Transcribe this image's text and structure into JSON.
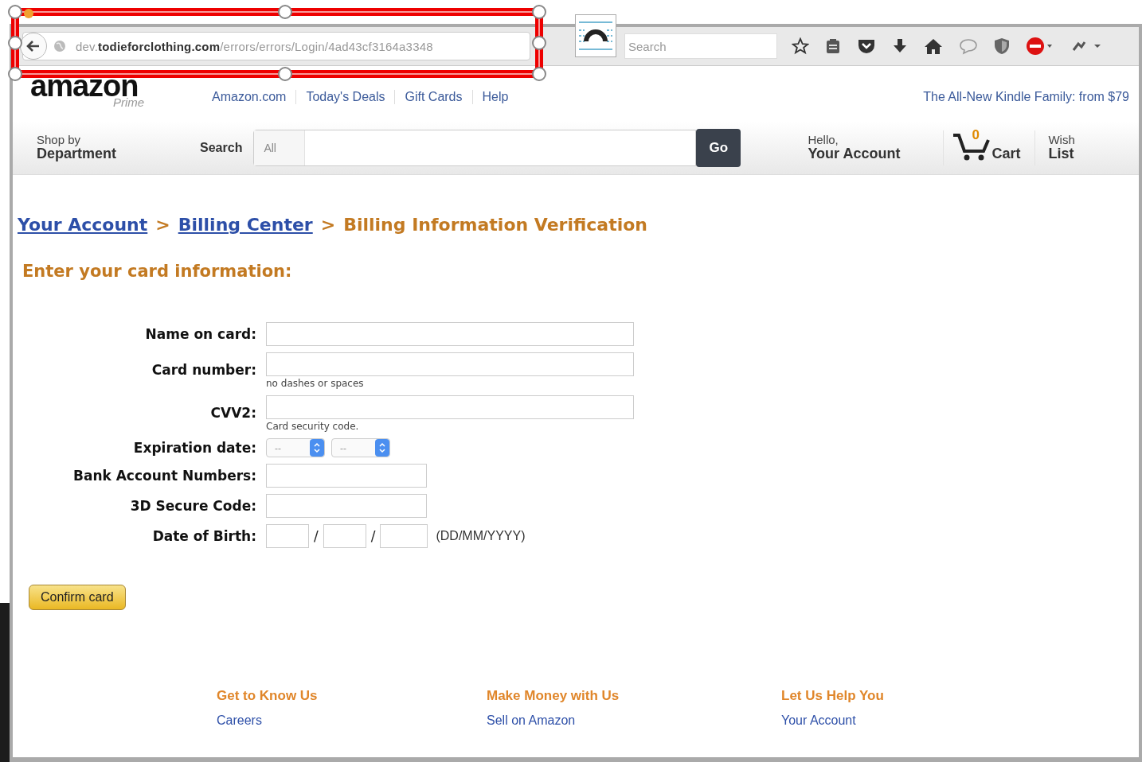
{
  "browser": {
    "url": "dev.**todieforclothing.com**/errors/errors/Login/4ad43cf3164a3348",
    "search": {
      "placeholder": "Search"
    }
  },
  "header": {
    "logo": "amazon",
    "logo_sub": "Prime",
    "links": [
      "Amazon.com",
      "Today's Deals",
      "Gift Cards",
      "Help"
    ],
    "promo": "The All-New Kindle Family: from $79"
  },
  "nav": {
    "shop_by": "Shop by",
    "department": "Department",
    "search_label": "Search",
    "category": "All",
    "go": "Go",
    "hello": "Hello,",
    "account": "Your Account",
    "cart_count": "0",
    "cart": "Cart",
    "wish": "Wish",
    "list": "List"
  },
  "breadcrumb": [
    {
      "kind": "link",
      "label": "Your Account"
    },
    {
      "kind": "sep",
      "label": ">"
    },
    {
      "kind": "link",
      "label": "Billing Center"
    },
    {
      "kind": "sep",
      "label": ">"
    },
    {
      "kind": "current",
      "label": "Billing Information Verification"
    }
  ],
  "heading": "Enter your card information:",
  "form": [
    {
      "kind": "wide",
      "label": "Name on card:"
    },
    {
      "kind": "wide",
      "label": "Card number:",
      "hint": "no dashes or spaces"
    },
    {
      "kind": "wide",
      "label": "CVV2:",
      "hint": "Card security code."
    },
    {
      "kind": "selects",
      "label": "Expiration date:",
      "values": [
        "--",
        "--"
      ]
    },
    {
      "kind": "narrow",
      "label": "Bank Account Numbers:"
    },
    {
      "kind": "narrow",
      "label": "3D Secure Code:"
    },
    {
      "kind": "date",
      "label": "Date of Birth:",
      "separators": [
        "/",
        "/"
      ],
      "format": "(DD/MM/YYYY)"
    }
  ],
  "confirm": "Confirm card",
  "footer": [
    {
      "title": "Get to Know Us",
      "link": "Careers"
    },
    {
      "title": "Make Money with Us",
      "link": "Sell on Amazon"
    },
    {
      "title": "Let Us Help You",
      "link": "Your Account"
    }
  ]
}
